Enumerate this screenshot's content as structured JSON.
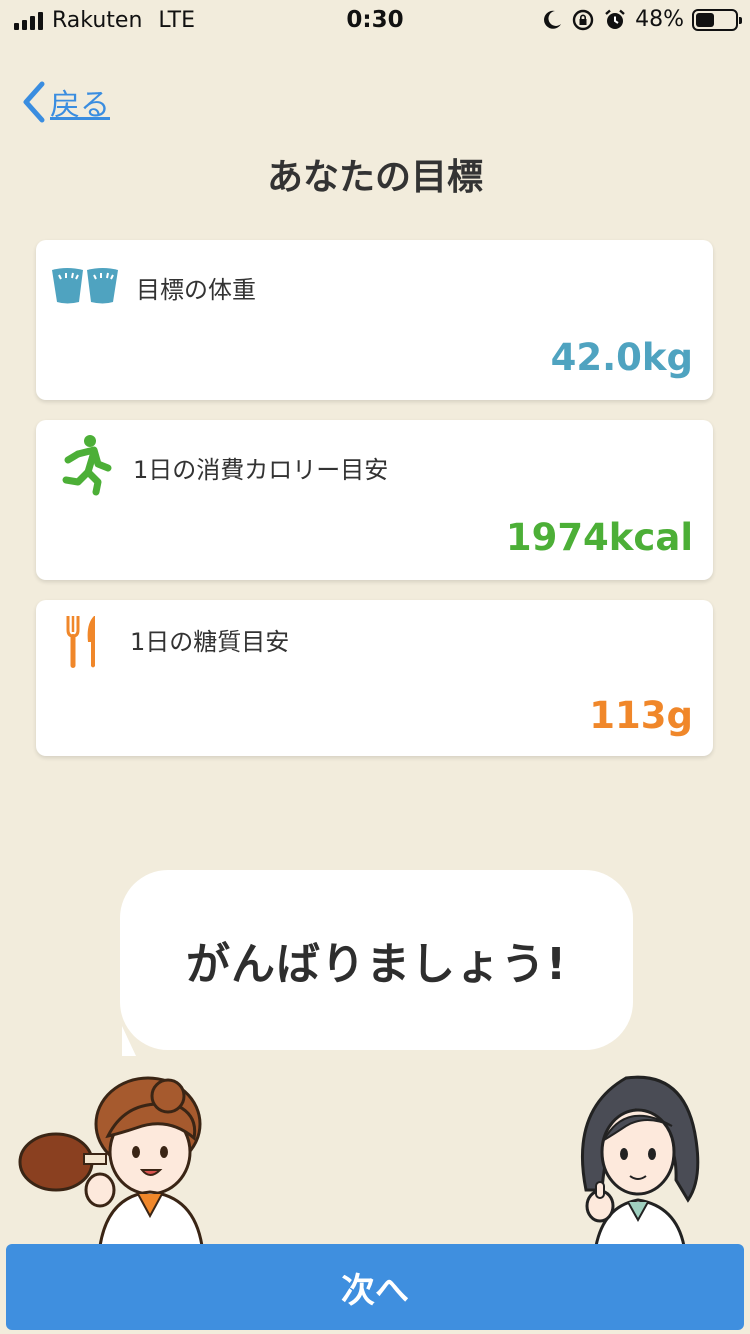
{
  "status_bar": {
    "carrier": "Rakuten",
    "network": "LTE",
    "time": "0:30",
    "battery_percent": "48%"
  },
  "nav": {
    "back_label": "戻る",
    "title": "あなたの目標"
  },
  "cards": [
    {
      "icon": "scale-icon",
      "label": "目標の体重",
      "value": "42.0kg",
      "color": "#4fa3c0"
    },
    {
      "icon": "running-icon",
      "label": "1日の消費カロリー目安",
      "value": "1974kcal",
      "color": "#4caf37"
    },
    {
      "icon": "fork-knife-icon",
      "label": "1日の糖質目安",
      "value": "113g",
      "color": "#f0872a"
    }
  ],
  "bubble": {
    "text": "がんばりましょう!"
  },
  "next_button": {
    "label": "次へ"
  },
  "colors": {
    "background": "#f2ecdc",
    "accent": "#3f8fdf",
    "link": "#3a8de0"
  }
}
